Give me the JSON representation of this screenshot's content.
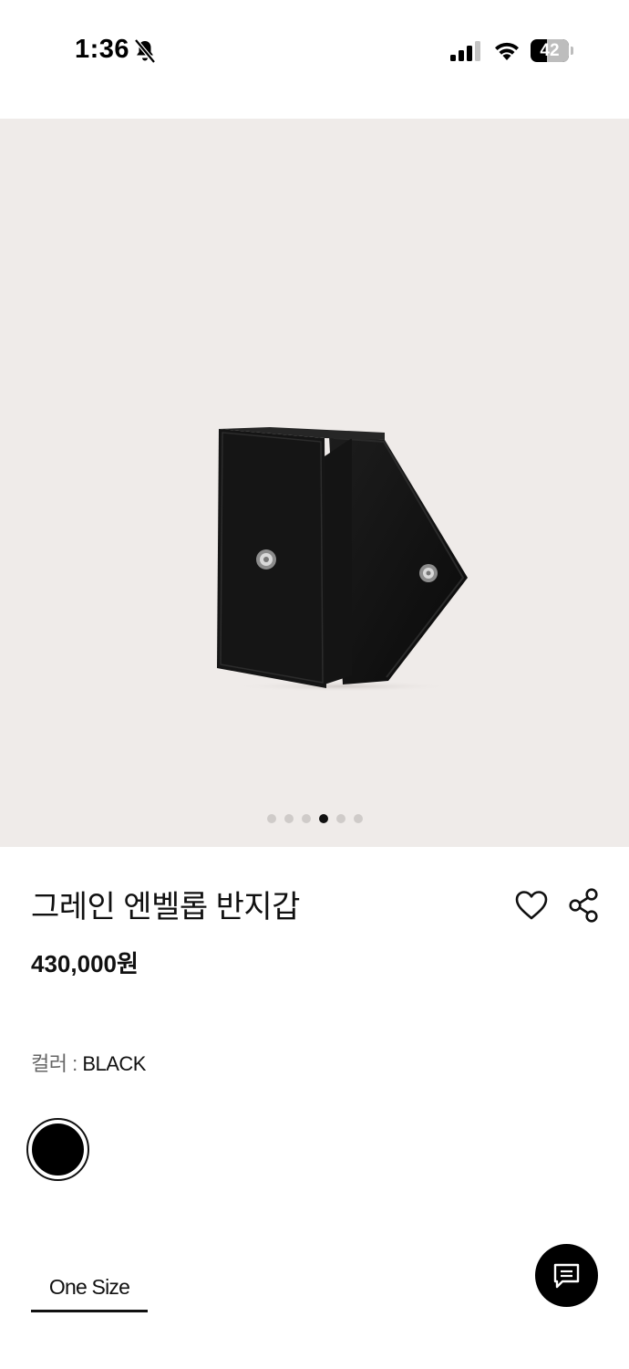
{
  "status_bar": {
    "time": "1:36",
    "battery": "42",
    "battery_level": 0.42,
    "icons": [
      "bell-muted-icon",
      "signal-icon",
      "wifi-icon",
      "battery-icon"
    ]
  },
  "gallery": {
    "image": "black-leather-wallet",
    "page_count": 6,
    "active_page": 4
  },
  "product": {
    "title": "그레인 엔벨롭 반지갑",
    "price": "430,000원"
  },
  "actions": {
    "icons": [
      "heart-icon",
      "share-icon"
    ]
  },
  "color": {
    "label": "컬러 : ",
    "value": "BLACK",
    "swatch_hex": "#000000"
  },
  "size": {
    "selected": "One Size"
  },
  "chat": {
    "icon": "chat-icon"
  },
  "colors": {
    "gallery_bg": "#efebe9",
    "accent": "#111111"
  }
}
